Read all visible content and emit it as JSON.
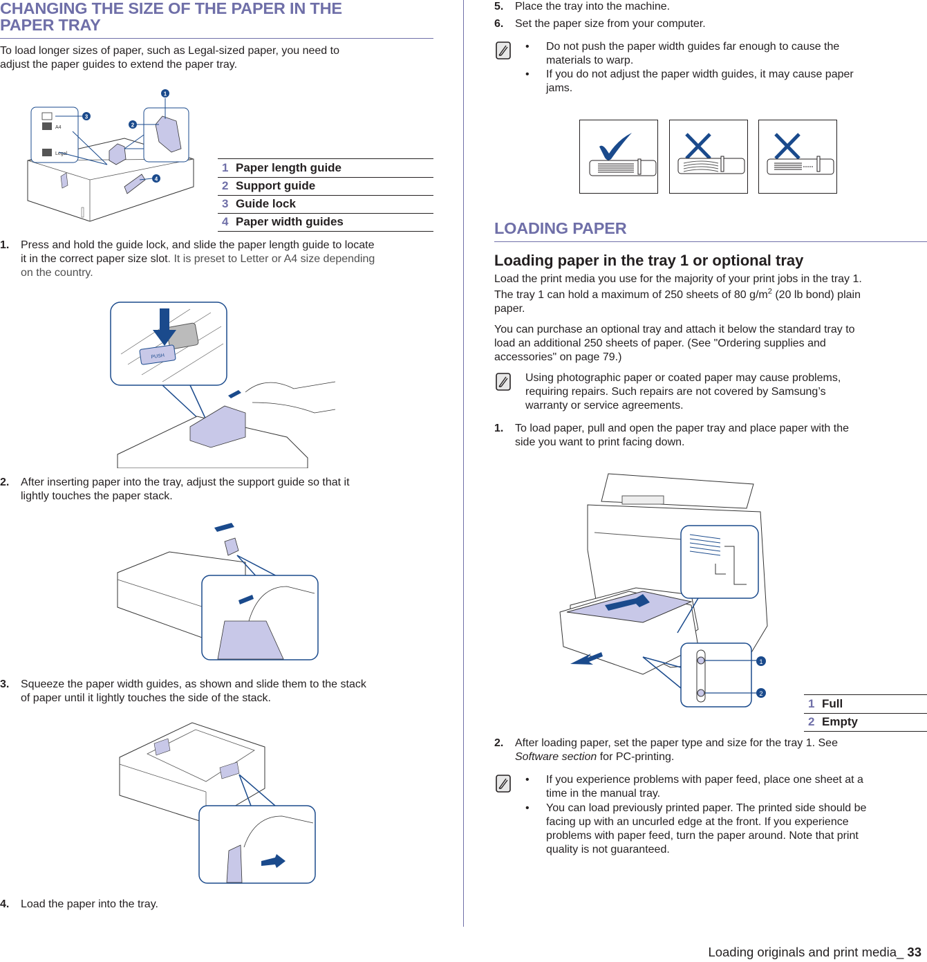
{
  "left_column": {
    "section_title": "CHANGING THE SIZE OF THE PAPER IN THE PAPER TRAY",
    "section_title_line1": "CHANGING THE SIZE OF THE PAPER IN THE",
    "section_title_line2": "PAPER TRAY",
    "intro": "To load longer sizes of paper, such as Legal-sized paper, you need to adjust the paper guides to extend the paper tray.",
    "intro_line1": "To load longer sizes of paper, such as Legal-sized paper, you need to",
    "intro_line2": "adjust the paper guides to extend the paper tray.",
    "figure1": {
      "callouts": [
        "1",
        "2",
        "3",
        "4"
      ],
      "labels": {
        "a4": "A4",
        "legal": "Legal"
      }
    },
    "legend": [
      {
        "num": "1",
        "label": "Paper length guide"
      },
      {
        "num": "2",
        "label": "Support guide"
      },
      {
        "num": "3",
        "label": "Guide lock"
      },
      {
        "num": "4",
        "label": "Paper width guides"
      }
    ],
    "steps": [
      {
        "num": "1.",
        "line1": "Press and hold the guide lock, and slide the paper length guide to locate",
        "line2_main": "it in the correct paper size slot",
        "line2_gray": ". It is preset to Letter or A4 size depending",
        "line3": "on the country."
      },
      {
        "num": "2.",
        "line1": "After inserting paper into the tray, adjust the support guide so that it",
        "line2": "lightly touches the paper stack."
      },
      {
        "num": "3.",
        "line1": "Squeeze the paper width guides, as shown and slide them to the stack",
        "line2": "of paper until it lightly touches the side of the stack."
      },
      {
        "num": "4.",
        "line1": "Load the paper into the tray."
      }
    ],
    "figure2": {
      "push_label": "PUSH"
    }
  },
  "right_column": {
    "steps_top": [
      {
        "num": "5.",
        "text": "Place the tray into the machine."
      },
      {
        "num": "6.",
        "text": "Set the paper size from your computer."
      }
    ],
    "note1": {
      "icon": "note-pencil-icon",
      "bullets": [
        {
          "line1": "Do not push the paper width guides far enough to cause the",
          "line2": "materials to warp."
        },
        {
          "line1": "If you do not adjust the paper width guides, it may cause paper",
          "line2": "jams."
        }
      ]
    },
    "guide_examples": [
      {
        "status": "correct",
        "icon": "checkmark-icon"
      },
      {
        "status": "incorrect",
        "icon": "cross-icon"
      },
      {
        "status": "incorrect",
        "icon": "cross-icon"
      }
    ],
    "section_title": "LOADING PAPER",
    "subsection_title": "Loading paper in the tray 1 or optional tray",
    "para1_line1": "Load the print media you use for the majority of your print jobs in the tray 1.",
    "para1_line2_a": "The tray 1 can hold a maximum of 250 sheets of 80 g/m",
    "para1_line2_sup": "2",
    "para1_line2_b": " (20 lb bond) plain",
    "para1_line3": "paper.",
    "para2_line1": "You can purchase an optional tray and attach it below the standard tray to",
    "para2_line2": "load an additional 250 sheets of paper. (See \"Ordering supplies and",
    "para2_line3": "accessories\" on page 79.)",
    "note2": {
      "icon": "note-pencil-icon",
      "line1": "Using photographic paper or coated paper may cause problems,",
      "line2": "requiring repairs. Such repairs are not covered by Samsung’s",
      "line3": "warranty or service agreements."
    },
    "step1": {
      "num": "1.",
      "line1": "To load paper, pull and open the paper tray and place paper with the",
      "line2": "side you want to print facing down."
    },
    "figure3": {
      "callouts": [
        "1",
        "2"
      ]
    },
    "legend": [
      {
        "num": "1",
        "label": "Full"
      },
      {
        "num": "2",
        "label": "Empty"
      }
    ],
    "step2": {
      "num": "2.",
      "line1": "After loading paper, set the paper type and size for the tray 1. See",
      "line2_italic": "Software section",
      "line2_rest": " for PC-printing."
    },
    "note3": {
      "icon": "note-pencil-icon",
      "bullets": [
        {
          "line1": "If you experience problems with paper feed, place one sheet at a",
          "line2": "time in the manual tray."
        },
        {
          "line1": "You can load previously printed paper. The printed side should be",
          "line2": "facing up with an uncurled edge at the front. If you experience",
          "line3": "problems with paper feed, turn the paper around. Note that print",
          "line4": "quality is not guaranteed."
        }
      ]
    }
  },
  "footer": {
    "chapter": "Loading originals and print media_",
    "page_number": "33"
  },
  "colors": {
    "heading": "#6f6fa8",
    "text": "#231f20",
    "illustration_blue": "#1a4a8c",
    "illustration_fill": "#c8c8e8"
  }
}
